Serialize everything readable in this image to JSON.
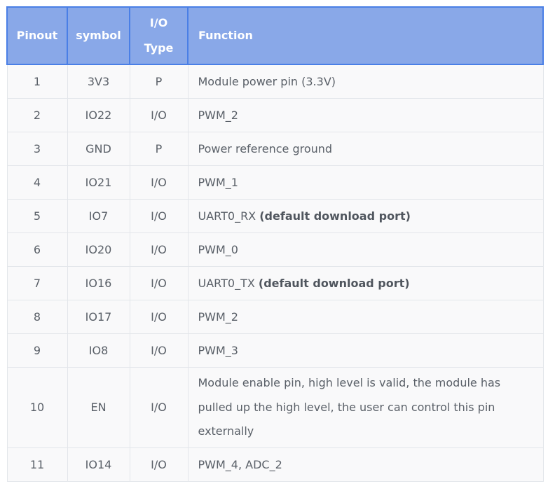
{
  "headers": {
    "pinout": "Pinout",
    "symbol": "symbol",
    "io_type_line1": "I/O",
    "io_type_line2": "Type",
    "function": "Function"
  },
  "rows": [
    {
      "pinout": "1",
      "symbol": "3V3",
      "io": "P",
      "function": "Module power pin (3.3V)",
      "note": ""
    },
    {
      "pinout": "2",
      "symbol": "IO22",
      "io": "I/O",
      "function": "PWM_2",
      "note": ""
    },
    {
      "pinout": "3",
      "symbol": "GND",
      "io": "P",
      "function": "Power reference ground",
      "note": ""
    },
    {
      "pinout": "4",
      "symbol": "IO21",
      "io": "I/O",
      "function": "PWM_1",
      "note": ""
    },
    {
      "pinout": "5",
      "symbol": "IO7",
      "io": "I/O",
      "function": "UART0_RX ",
      "note": "(default download port)"
    },
    {
      "pinout": "6",
      "symbol": "IO20",
      "io": "I/O",
      "function": "PWM_0",
      "note": ""
    },
    {
      "pinout": "7",
      "symbol": "IO16",
      "io": "I/O",
      "function": "UART0_TX ",
      "note": "(default download port)"
    },
    {
      "pinout": "8",
      "symbol": "IO17",
      "io": "I/O",
      "function": "PWM_2",
      "note": ""
    },
    {
      "pinout": "9",
      "symbol": "IO8",
      "io": "I/O",
      "function": "PWM_3",
      "note": ""
    },
    {
      "pinout": "10",
      "symbol": "EN",
      "io": "I/O",
      "function": "Module enable pin, high level is valid, the module has pulled up the high level, the user can control this pin externally",
      "note": ""
    },
    {
      "pinout": "11",
      "symbol": "IO14",
      "io": "I/O",
      "function": "PWM_4, ADC_2",
      "note": ""
    }
  ],
  "colors": {
    "header_bg": "#89a8e8",
    "header_border": "#4a7fe6",
    "cell_bg": "#f9f9fa"
  }
}
